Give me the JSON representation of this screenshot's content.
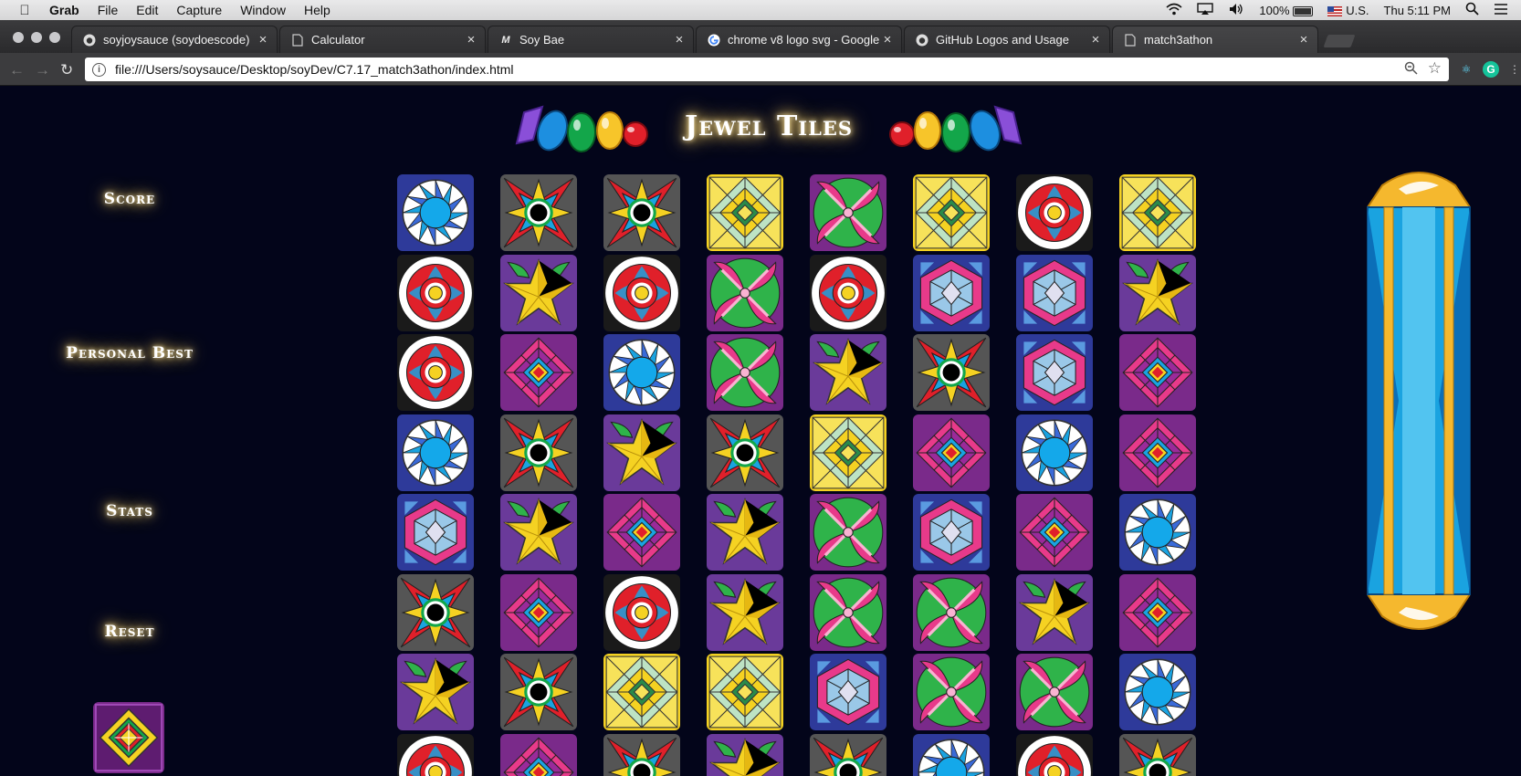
{
  "menubar": {
    "app_name": "Grab",
    "menus": [
      "File",
      "Edit",
      "Capture",
      "Window",
      "Help"
    ],
    "battery": "100%",
    "input_source": "U.S.",
    "clock": "Thu 5:11 PM"
  },
  "tabs": [
    {
      "title": "soyjoysauce (soydoescode)",
      "icon": "github-icon"
    },
    {
      "title": "Calculator",
      "icon": "document-icon"
    },
    {
      "title": "Soy Bae",
      "icon": "m-logo-icon"
    },
    {
      "title": "chrome v8 logo svg - Google S",
      "icon": "google-icon"
    },
    {
      "title": "GitHub Logos and Usage",
      "icon": "github-icon"
    },
    {
      "title": "match3athon",
      "icon": "document-icon",
      "active": true
    }
  ],
  "address_bar": {
    "url": "file:///Users/soysauce/Desktop/soyDev/C7.17_match3athon/index.html"
  },
  "game": {
    "title": "Jewel Tiles",
    "sidebar": {
      "score_label": "Score",
      "personal_best_label": "Personal Best",
      "stats_label": "Stats",
      "reset_label": "Reset"
    },
    "tile_types": [
      "sun",
      "bullseye",
      "burst",
      "mosaic",
      "flower",
      "star",
      "cube",
      "quilt"
    ],
    "preview_tile": "diamond",
    "board": [
      [
        "sun",
        "burst",
        "burst",
        "mosaic",
        "flower",
        "mosaic",
        "bullseye",
        "mosaic"
      ],
      [
        "bullseye",
        "star",
        "bullseye",
        "flower",
        "bullseye",
        "cube",
        "cube",
        "star"
      ],
      [
        "bullseye",
        "quilt",
        "sun",
        "flower",
        "star",
        "burst",
        "cube",
        "quilt"
      ],
      [
        "sun",
        "burst",
        "star",
        "burst",
        "mosaic",
        "quilt",
        "sun",
        "quilt"
      ],
      [
        "cube",
        "star",
        "quilt",
        "star",
        "flower",
        "cube",
        "quilt",
        "sun"
      ],
      [
        "burst",
        "quilt",
        "bullseye",
        "star",
        "flower",
        "flower",
        "star",
        "quilt"
      ],
      [
        "star",
        "burst",
        "mosaic",
        "mosaic",
        "cube",
        "flower",
        "flower",
        "sun"
      ],
      [
        "bullseye",
        "quilt",
        "burst",
        "star",
        "burst",
        "sun",
        "bullseye",
        "burst"
      ]
    ]
  },
  "colors": {
    "page_bg": "#03051a",
    "glow": "#ffd66b",
    "meter_blue": "#1aa3e0",
    "meter_gold": "#f5b82e"
  }
}
